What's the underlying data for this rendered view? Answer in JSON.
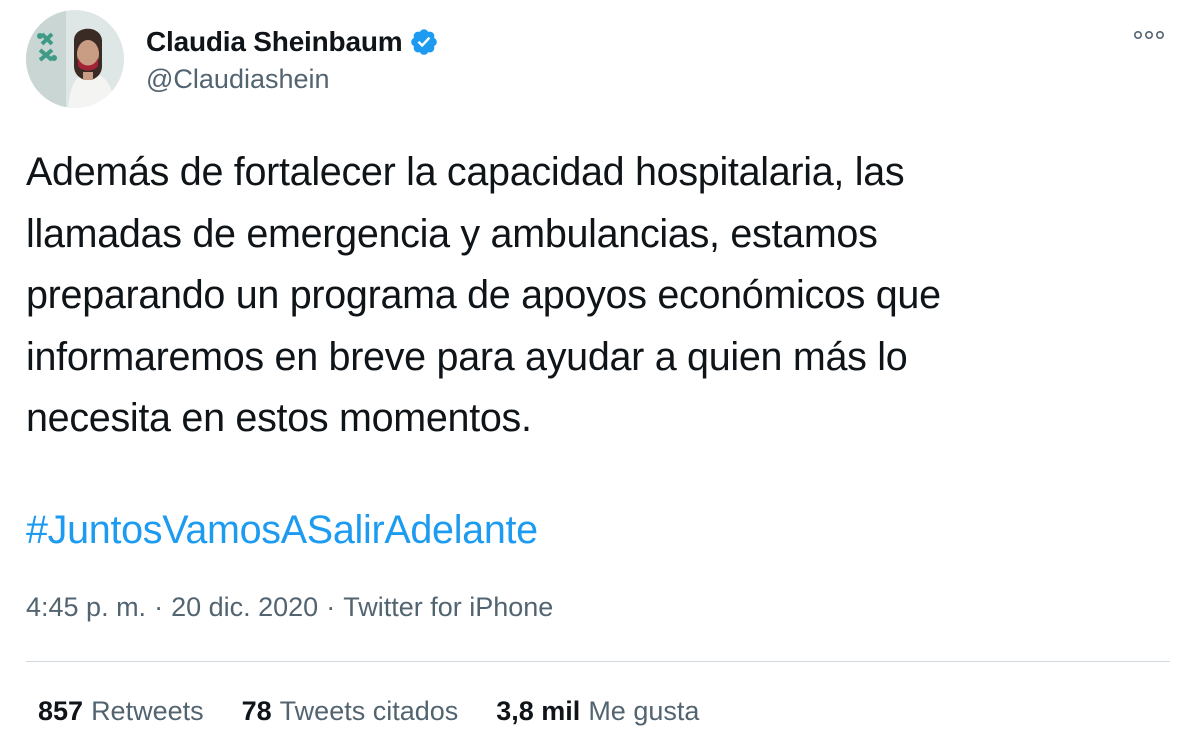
{
  "author": {
    "display_name": "Claudia Sheinbaum",
    "handle": "@Claudiashein",
    "verified_icon": "verified-badge-icon",
    "verified_color": "#1d9bf0"
  },
  "menu": {
    "more_icon": "more-options-icon"
  },
  "tweet": {
    "text": "Además de fortalecer la capacidad hospitalaria, las\nllamadas de emergencia y ambulancias, estamos\npreparando un programa de apoyos económicos que\ninformaremos en breve para ayudar a quien más lo\nnecesita en estos momentos.",
    "hashtag": "#JuntosVamosASalirAdelante",
    "hashtag_color": "#1d9bf0"
  },
  "meta": {
    "time": "4:45 p. m.",
    "separator": "·",
    "date": "20 dic. 2020",
    "source": "Twitter for iPhone"
  },
  "stats": {
    "retweets": {
      "value": "857",
      "label": "Retweets"
    },
    "quotes": {
      "value": "78",
      "label": "Tweets citados"
    },
    "likes": {
      "value": "3,8 mil",
      "label": "Me gusta"
    }
  }
}
